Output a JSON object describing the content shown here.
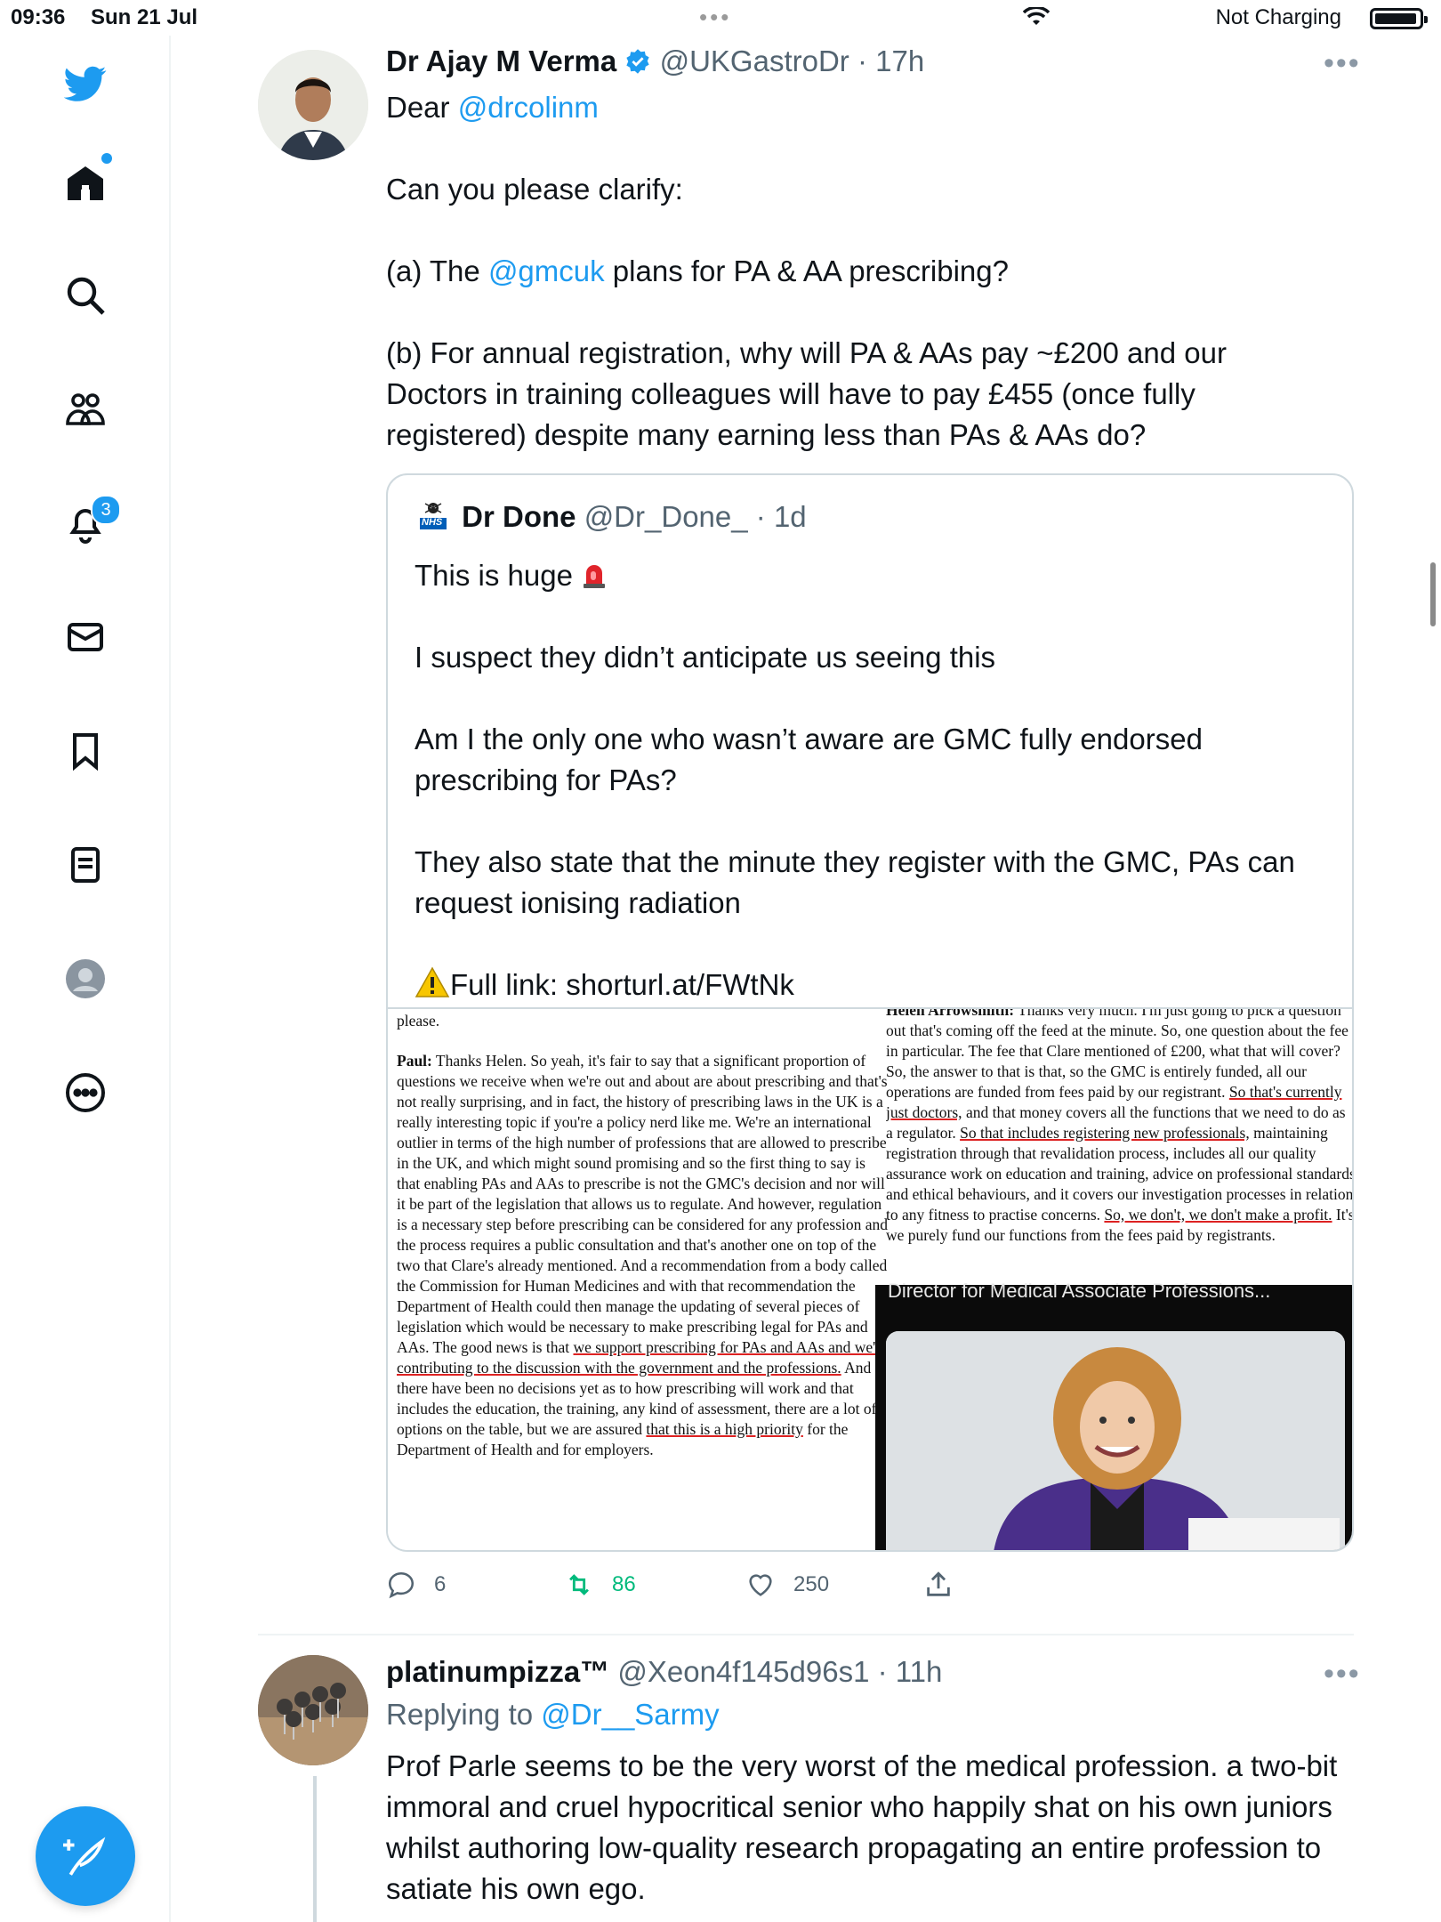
{
  "status_bar": {
    "time": "09:36",
    "date": "Sun 21 Jul",
    "charging": "Not Charging",
    "battery_level": 0.95
  },
  "sidebar": {
    "items": [
      {
        "icon": "twitter-bird-icon"
      },
      {
        "icon": "home-icon"
      },
      {
        "icon": "search-icon"
      },
      {
        "icon": "communities-icon"
      },
      {
        "icon": "bell-icon",
        "badge": "3"
      },
      {
        "icon": "mail-icon"
      },
      {
        "icon": "bookmark-icon"
      },
      {
        "icon": "lists-icon"
      },
      {
        "icon": "profile-icon"
      },
      {
        "icon": "more-icon"
      }
    ],
    "compose_icon": "feather-plus-icon"
  },
  "tweet": {
    "name": "Dr Ajay M Verma",
    "handle": "@UKGastroDr",
    "time": "· 17h",
    "verified": true,
    "line1_prefix": "Dear ",
    "line1_mention": "@drcolinm",
    "line2": "Can you please clarify:",
    "line3_prefix": "(a) The ",
    "line3_mention": "@gmcuk",
    "line3_suffix": " plans for PA & AA prescribing?",
    "line4": "(b) For annual registration, why will PA & AAs pay ~£200 and our Doctors in training colleagues will have to pay £455 (once fully registered) despite many earning less than PAs & AAs do?",
    "stats": {
      "replies": "6",
      "retweets": "86",
      "likes": "250"
    }
  },
  "quote": {
    "name": "Dr Done",
    "handle": "@Dr_Done_",
    "time": "· 1d",
    "avatar_label": "NHS",
    "p1": "This is huge",
    "p2": "I suspect they didn’t anticipate us seeing this",
    "p3": "Am I the only one who wasn’t aware are GMC fully endorsed prescribing for PAs?",
    "p4": "They also state that the minute they register with the GMC, PAs can request ionising radiation",
    "p5": "Full link: shorturl.at/FWtNk"
  },
  "document": {
    "left_top": "please.",
    "left_speaker": "Paul:",
    "left_a": " Thanks Helen. So yeah, it's fair to say that a significant proportion of questions we receive when we're out and about are about prescribing and that's not really surprising, and in fact, the history of prescribing laws in the UK is a really interesting topic if you're a policy nerd like me. We're an international outlier in terms of the high number of professions that are allowed to prescribe in the UK, and which might sound promising and so the first thing to say is that enabling PAs and AAs to prescribe is not the GMC's decision and nor will it be part of the legislation that allows us to regulate. And however, regulation is a necessary step before prescribing can be considered for any profession and the process requires a public consultation and that's another one on top of the two that Clare's already mentioned. And a recommendation from a body called the Commission for Human Medicines and with that recommendation the Department of Health could then manage the updating of several pieces of legislation which would be necessary to make prescribing legal for PAs and AAs. The good news is that ",
    "left_ul1": "we support prescribing for PAs and AAs and we're contributing to the discussion with the government and the professions.",
    "left_b": " And there have been no decisions yet as to how prescribing will work and that includes the education, the training, any kind of assessment, there are a lot of options on the table, but we are assured ",
    "left_ul2": "that this is a high priority",
    "left_c": " for the Department of Health and for employers.",
    "right_speaker": "Helen Arrowsmith:",
    "right_a": " Thanks very much. I'm just going to pick a question out that's coming off the feed at the minute. So, one question about the fee in particular. The fee that Clare mentioned of £200, what that will cover? So, the answer to that is that, so the GMC is entirely funded, all our operations are funded from fees paid by our registrant. ",
    "right_ul1": "So that's currently just doctors,",
    "right_b": " and that money covers all the functions that we need to do as a regulator. ",
    "right_ul2": "So that includes registering new professionals,",
    "right_c": " maintaining registration through that revalidation process, includes all our quality assurance work on education and training, advice on professional standards and ethical behaviours, and it covers our investigation processes in relation to any fitness to practise concerns. ",
    "right_ul3": "So, we don't, we don't make a profit.",
    "right_d": " It's we purely fund our functions from the fees paid by registrants.",
    "video_caption": "Director for Medical Associate Professions..."
  },
  "reply": {
    "name": "platinumpizza™",
    "handle": "@Xeon4f145d96s1",
    "time": "· 11h",
    "replying_prefix": "Replying to ",
    "replying_mention": "@Dr__Sarmy",
    "text": "Prof Parle seems to be the very worst of the medical profession. a two-bit immoral and cruel hypocritical senior who happily shat on his own juniors whilst authoring low-quality research propagating an entire profession to satiate his own ego."
  },
  "colors": {
    "accent": "#1d9bf0",
    "retweet": "#00ba7c",
    "muted": "#536471",
    "underline_red": "#dd2222"
  }
}
